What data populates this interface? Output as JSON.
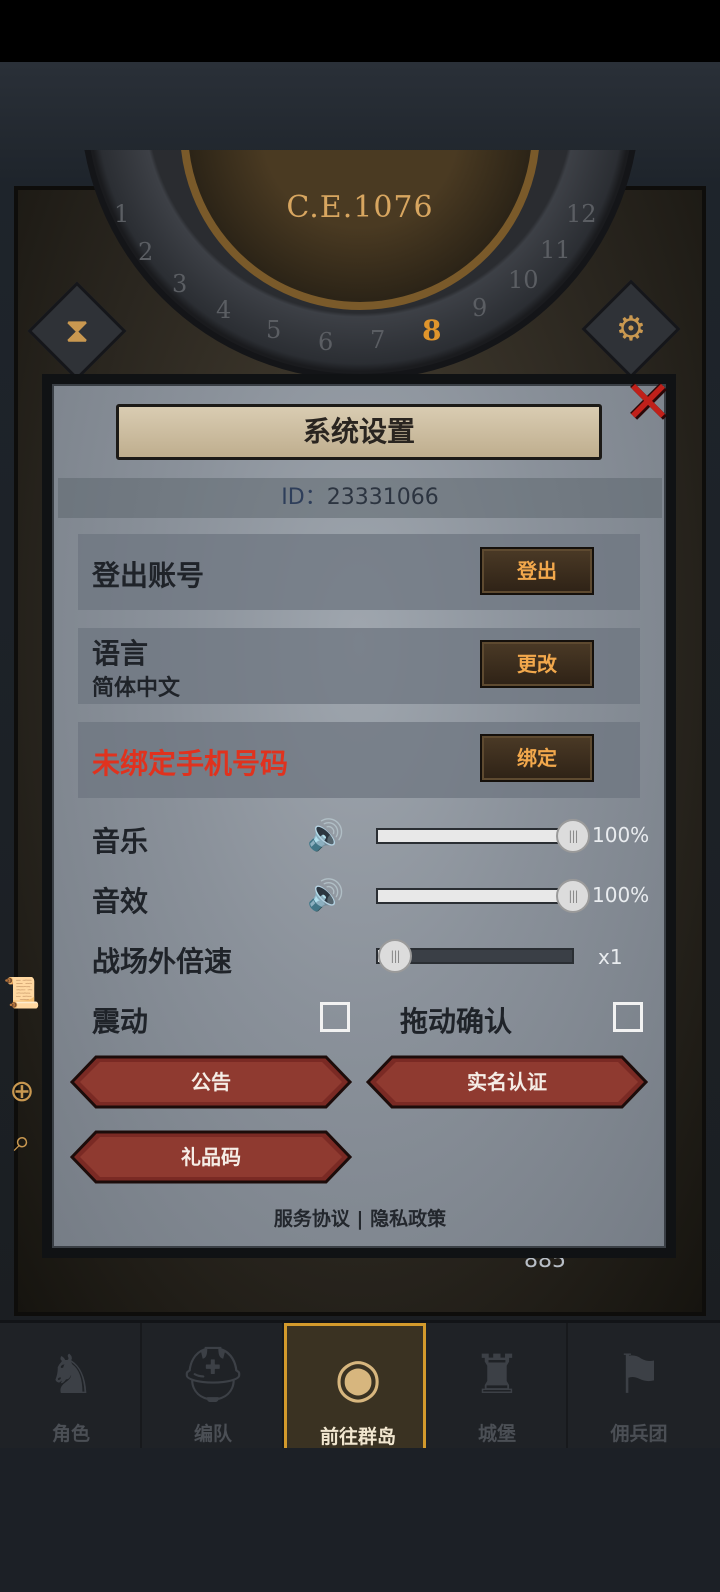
{
  "header": {
    "year": "C.E.1076"
  },
  "dial": {
    "numbers": [
      "1",
      "2",
      "3",
      "4",
      "5",
      "6",
      "7",
      "8",
      "9",
      "10",
      "11",
      "12"
    ],
    "active": "8"
  },
  "dialog": {
    "title": "系统设置",
    "id_label": "ID：",
    "id_value": "23331066",
    "close_glyph": "✕",
    "logout": {
      "label": "登出账号",
      "button": "登出"
    },
    "language": {
      "label": "语言",
      "value": "简体中文",
      "button": "更改"
    },
    "phone": {
      "label": "未绑定手机号码",
      "button": "绑定"
    },
    "music": {
      "label": "音乐",
      "value": 100,
      "display": "100%"
    },
    "sfx": {
      "label": "音效",
      "value": 100,
      "display": "100%"
    },
    "speed": {
      "label": "战场外倍速",
      "value": 0,
      "display": "x1"
    },
    "vibration": {
      "label": "震动",
      "checked": false
    },
    "drag_confirm": {
      "label": "拖动确认",
      "checked": false
    },
    "buttons": {
      "notice": "公告",
      "realname": "实名认证",
      "gift": "礼品码"
    },
    "links": {
      "terms": "服务协议",
      "separator": "|",
      "privacy": "隐私政策"
    }
  },
  "background": {
    "gems": "885"
  },
  "nav": [
    {
      "label": "角色",
      "icon": "knight-icon"
    },
    {
      "label": "编队",
      "icon": "helmet-icon"
    },
    {
      "label": "前往群岛",
      "icon": "globe-icon",
      "active": true
    },
    {
      "label": "城堡",
      "icon": "castle-icon"
    },
    {
      "label": "佣兵团",
      "icon": "mercenary-icon"
    }
  ],
  "colors": {
    "accent": "#d39a2c",
    "warning": "#e0321e",
    "button_text": "#f2a84c"
  }
}
